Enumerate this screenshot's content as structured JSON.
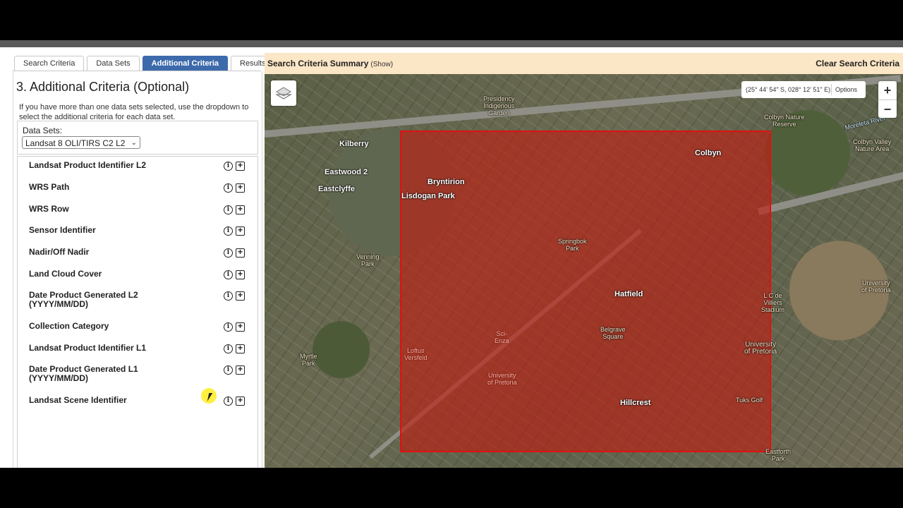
{
  "tabs": [
    {
      "label": "Search Criteria",
      "active": false
    },
    {
      "label": "Data Sets",
      "active": false
    },
    {
      "label": "Additional Criteria",
      "active": true
    },
    {
      "label": "Results",
      "active": false
    }
  ],
  "panel": {
    "heading": "3. Additional Criteria (Optional)",
    "help_text": "If you have more than one data sets selected, use the dropdown to select the additional criteria for each data set.",
    "datasets_label": "Data Sets:",
    "datasets_selected": "Landsat 8 OLI/TIRS C2 L2"
  },
  "criteria": [
    {
      "label": "Landsat Product Identifier L2",
      "sub": ""
    },
    {
      "label": "WRS Path",
      "sub": ""
    },
    {
      "label": "WRS Row",
      "sub": ""
    },
    {
      "label": "Sensor Identifier",
      "sub": ""
    },
    {
      "label": "Nadir/Off Nadir",
      "sub": ""
    },
    {
      "label": "Land Cloud Cover",
      "sub": ""
    },
    {
      "label": "Date Product Generated L2",
      "sub": "(YYYY/MM/DD)"
    },
    {
      "label": "Collection Category",
      "sub": ""
    },
    {
      "label": "Landsat Product Identifier L1",
      "sub": ""
    },
    {
      "label": "Date Product Generated L1",
      "sub": "(YYYY/MM/DD)"
    },
    {
      "label": "Landsat Scene Identifier",
      "sub": ""
    }
  ],
  "summary": {
    "title": "Search Criteria Summary",
    "show": "(Show)",
    "clear": "Clear Search Criteria"
  },
  "map": {
    "coordinates": "(25° 44' 54\" S, 028° 12' 51\" E)",
    "options": "Options",
    "zoom_in": "+",
    "zoom_out": "−",
    "places": {
      "kilberry": "Kilberry",
      "eastwood": "Eastwood 2",
      "eastclyffe": "Eastclyffe",
      "colbyn": "Colbyn",
      "bryntirion": "Bryntirion",
      "lisdogan": "Lisdogan Park",
      "hatfield": "Hatfield",
      "hillcrest": "Hillcrest",
      "presidency": "Presidency\nIndigenous\nGarden",
      "colbyn_reserve": "Colbyn Nature\nReserve",
      "colbyn_valley": "Colbyn Valley\nNature Area",
      "moreleta": "Moreleta River",
      "springbok": "Springbok\nPark",
      "venning": "Venning\nPark",
      "myrtle": "Myrtle\nPark",
      "belgrave": "Belgrave\nSquare",
      "sci_enza": "Sci-\nEnza",
      "loftus": "Loftus\nVersfeld",
      "uni_pretoria": "University\nof Pretoria",
      "uni_pretoria2": "University\nof Pretoria",
      "uni_pretoria3": "University\nof Pretoria",
      "lc_villiers": "L C de\nVilliers\nStadium",
      "tuks_golf": "Tuks Golf",
      "eastforth": "Eastforth\nPark"
    }
  }
}
